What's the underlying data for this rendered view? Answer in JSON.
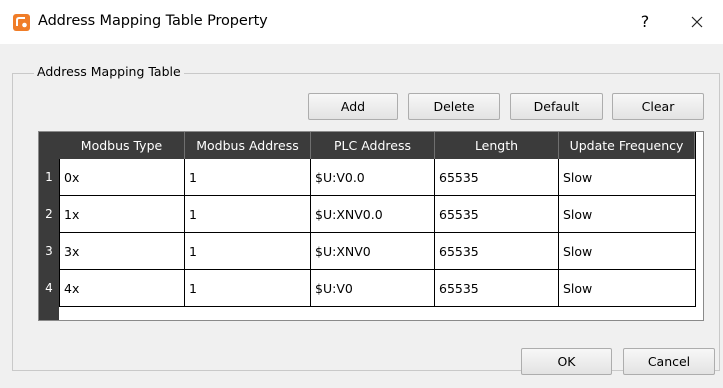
{
  "window": {
    "title": "Address Mapping Table Property",
    "help_label": "?"
  },
  "group": {
    "label": "Address Mapping Table"
  },
  "toolbar": {
    "add_label": "Add",
    "delete_label": "Delete",
    "default_label": "Default",
    "clear_label": "Clear"
  },
  "table": {
    "columns": [
      "Modbus Type",
      "Modbus Address",
      "PLC Address",
      "Length",
      "Update Frequency"
    ],
    "rows": [
      {
        "num": "1",
        "cells": [
          "0x",
          "1",
          "$U:V0.0",
          "65535",
          "Slow"
        ]
      },
      {
        "num": "2",
        "cells": [
          "1x",
          "1",
          "$U:XNV0.0",
          "65535",
          "Slow"
        ]
      },
      {
        "num": "3",
        "cells": [
          "3x",
          "1",
          "$U:XNV0",
          "65535",
          "Slow"
        ]
      },
      {
        "num": "4",
        "cells": [
          "4x",
          "1",
          "$U:V0",
          "65535",
          "Slow"
        ]
      }
    ]
  },
  "footer": {
    "ok_label": "OK",
    "cancel_label": "Cancel"
  },
  "icons": {
    "app": "app-icon",
    "close": "close-icon"
  },
  "colors": {
    "accent": "#f07d28",
    "table_header_bg": "#3b3b3b",
    "dialog_bg": "#f0f0f0"
  }
}
